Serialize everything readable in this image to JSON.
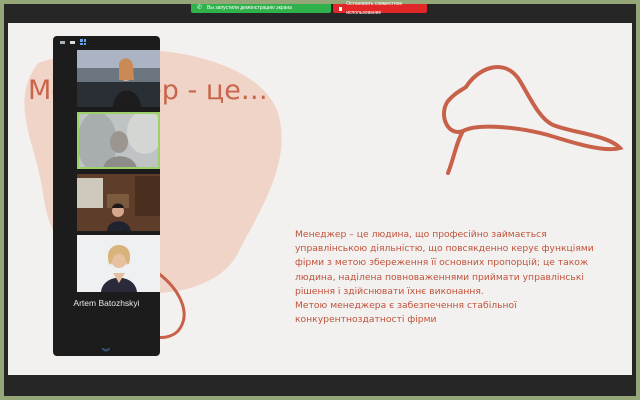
{
  "share_bar": {
    "status_text": "Вы запустили демонстрацию экрана",
    "stop_text": "Остановить совместное использование",
    "status_color": "#2fb24c",
    "stop_color": "#e02828"
  },
  "slide": {
    "title": "Менеджер - це…",
    "body": [
      "Менеджер – це людина, що професійно займається управлінською діяльністю, що повсякденно керує функціями фірми з метою збереження її основних пропорцій; це також людина, наділена повноваженнями приймати управлінські рішення і здійснювати їхнє виконання.",
      "Метою менеджера є забезпечення стабільної конкурентноздатності фірми"
    ],
    "accent_color": "#c8654b"
  },
  "participants": {
    "toolbar_icons": [
      "minimize-icon",
      "strip-view-icon",
      "gallery-view-icon"
    ],
    "tiles": [
      {
        "kind": "video",
        "active": false
      },
      {
        "kind": "video",
        "active": true
      },
      {
        "kind": "video",
        "active": false
      },
      {
        "kind": "video",
        "active": false
      }
    ],
    "name_tile": "Artem Batozhskyi",
    "scroll_icon": "chevron-down-icon"
  }
}
